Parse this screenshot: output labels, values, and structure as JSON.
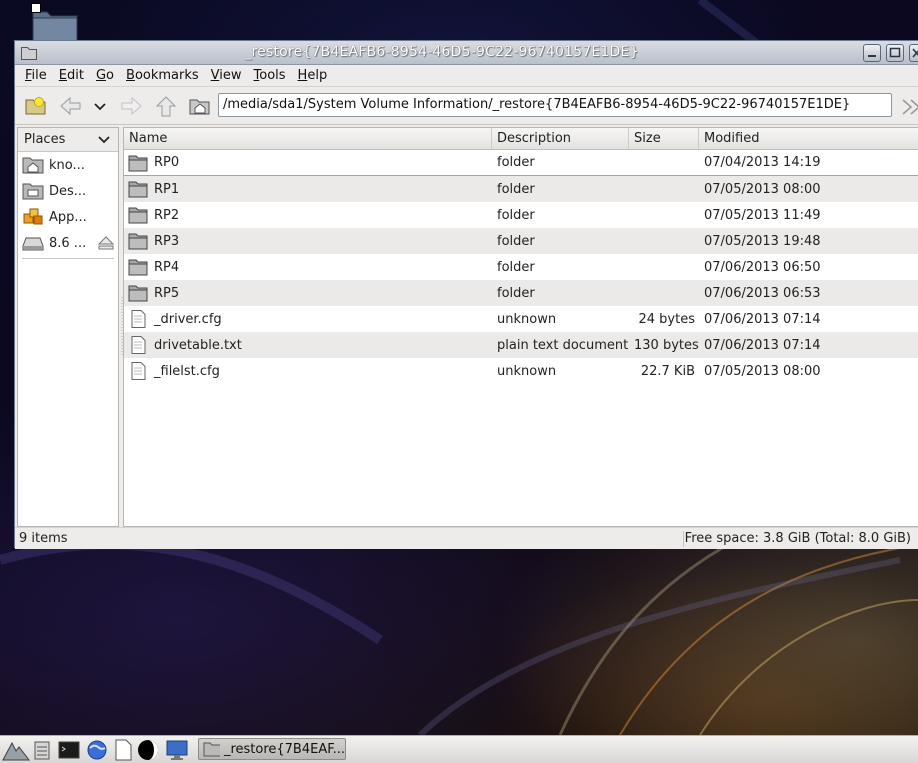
{
  "window": {
    "title": "_restore{7B4EAFB6-8954-46D5-9C22-96740157E1DE}"
  },
  "menu": [
    {
      "label": "File",
      "u": "F",
      "rest": "ile"
    },
    {
      "label": "Edit",
      "u": "E",
      "rest": "dit"
    },
    {
      "label": "Go",
      "u": "G",
      "rest": "o"
    },
    {
      "label": "Bookmarks",
      "u": "B",
      "rest": "ookmarks"
    },
    {
      "label": "View",
      "u": "V",
      "rest": "iew"
    },
    {
      "label": "Tools",
      "u": "T",
      "rest": "ools"
    },
    {
      "label": "Help",
      "u": "H",
      "rest": "elp"
    }
  ],
  "toolbar": {
    "location": "/media/sda1/System Volume Information/_restore{7B4EAFB6-8954-46D5-9C22-96740157E1DE}"
  },
  "sidebar": {
    "header": "Places",
    "items": [
      {
        "label": "kno...",
        "icon": "home-folder-icon"
      },
      {
        "label": "Des...",
        "icon": "desktop-folder-icon"
      },
      {
        "label": "App...",
        "icon": "applications-icon"
      },
      {
        "label": "8.6 ...",
        "icon": "drive-icon"
      }
    ]
  },
  "columns": {
    "name": "Name",
    "description": "Description",
    "size": "Size",
    "modified": "Modified"
  },
  "files": [
    {
      "name": "RP0",
      "description": "folder",
      "size": "",
      "modified": "07/04/2013 14:19",
      "type": "folder"
    },
    {
      "name": "RP1",
      "description": "folder",
      "size": "",
      "modified": "07/05/2013 08:00",
      "type": "folder"
    },
    {
      "name": "RP2",
      "description": "folder",
      "size": "",
      "modified": "07/05/2013 11:49",
      "type": "folder"
    },
    {
      "name": "RP3",
      "description": "folder",
      "size": "",
      "modified": "07/05/2013 19:48",
      "type": "folder"
    },
    {
      "name": "RP4",
      "description": "folder",
      "size": "",
      "modified": "07/06/2013 06:50",
      "type": "folder"
    },
    {
      "name": "RP5",
      "description": "folder",
      "size": "",
      "modified": "07/06/2013 06:53",
      "type": "folder"
    },
    {
      "name": "_driver.cfg",
      "description": "unknown",
      "size": "24 bytes",
      "modified": "07/06/2013 07:14",
      "type": "file"
    },
    {
      "name": "drivetable.txt",
      "description": "plain text document",
      "size": "130 bytes",
      "modified": "07/06/2013 07:14",
      "type": "file"
    },
    {
      "name": "_filelst.cfg",
      "description": "unknown",
      "size": "22.7 KiB",
      "modified": "07/05/2013 08:00",
      "type": "file"
    }
  ],
  "status": {
    "items": "9 items",
    "free_space": "Free space: 3.8 GiB (Total: 8.0 GiB)"
  },
  "taskbar": {
    "task_label": "_restore{7B4EAF..."
  },
  "colors": {
    "title_gradient_top": "#d9dde3",
    "row_alt": "#ebeae9",
    "window_bg": "#edeceb"
  }
}
